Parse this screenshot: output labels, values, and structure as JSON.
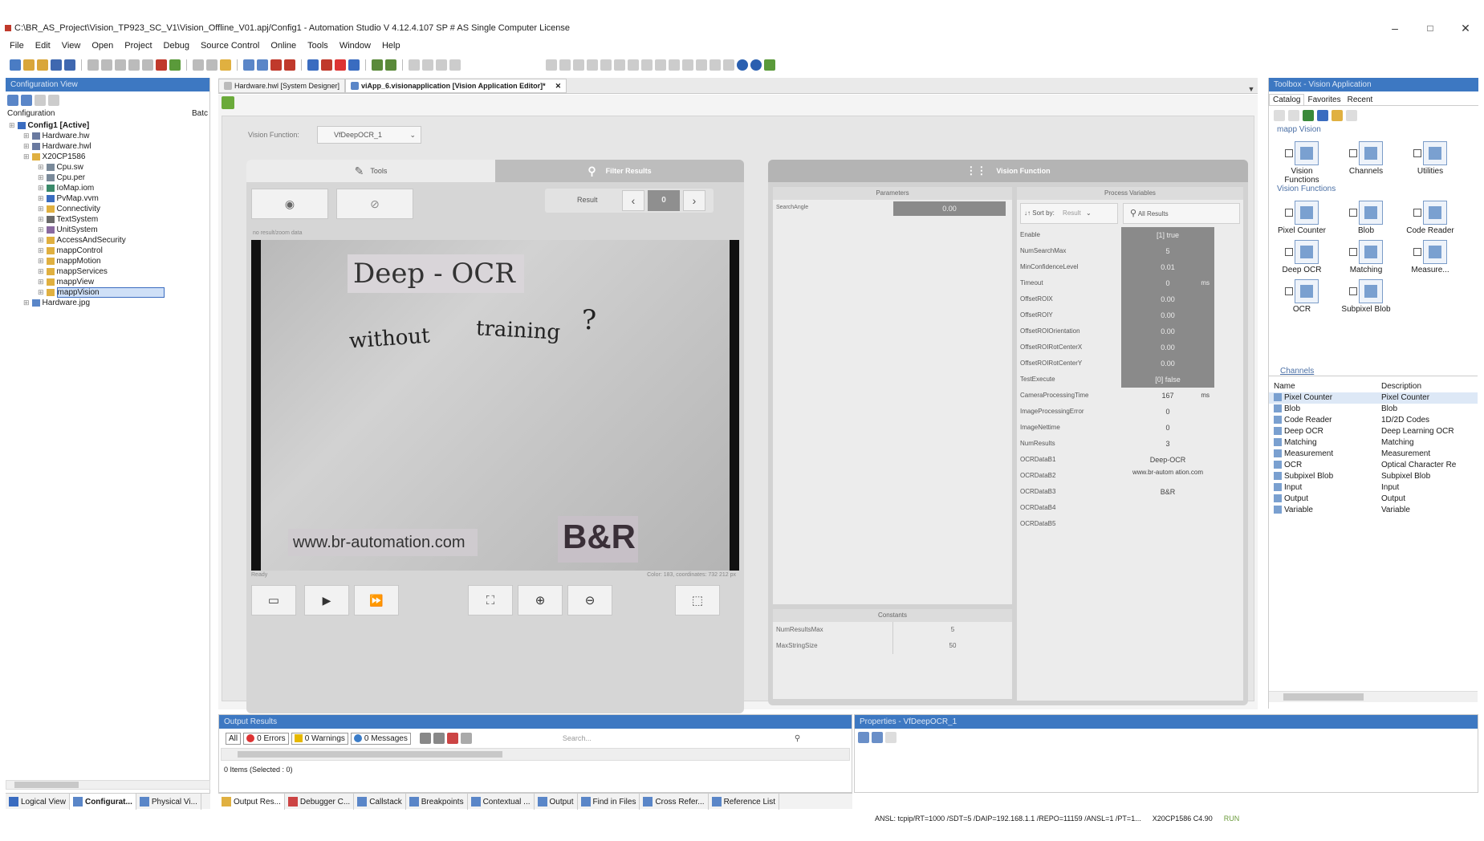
{
  "window": {
    "title": "C:\\BR_AS_Project\\Vision_TP923_SC_V1\\Vision_Offline_V01.apj/Config1 - Automation Studio V 4.12.4.107 SP # AS Single Computer License",
    "minimize": "–",
    "restore": "□",
    "close": "✕"
  },
  "menu": [
    "File",
    "Edit",
    "View",
    "Open",
    "Project",
    "Debug",
    "Source Control",
    "Online",
    "Tools",
    "Window",
    "Help"
  ],
  "config_view": {
    "header": "Configuration View",
    "col_config": "Configuration",
    "col_bat": "Batc",
    "tree": [
      {
        "label": "Config1 [Active]",
        "level": 0,
        "icon": "config-icon",
        "bold": true
      },
      {
        "label": "Hardware.hw",
        "level": 1,
        "icon": "hardware-icon"
      },
      {
        "label": "Hardware.hwl",
        "level": 1,
        "icon": "hardware-icon"
      },
      {
        "label": "X20CP1586",
        "level": 1,
        "icon": "folder-icon"
      },
      {
        "label": "Cpu.sw",
        "level": 2,
        "icon": "cpu-icon"
      },
      {
        "label": "Cpu.per",
        "level": 2,
        "icon": "cpu-icon"
      },
      {
        "label": "IoMap.iom",
        "level": 2,
        "icon": "iomap-icon"
      },
      {
        "label": "PvMap.vvm",
        "level": 2,
        "icon": "pvmap-icon"
      },
      {
        "label": "Connectivity",
        "level": 2,
        "icon": "folder-icon"
      },
      {
        "label": "TextSystem",
        "level": 2,
        "icon": "text-icon"
      },
      {
        "label": "UnitSystem",
        "level": 2,
        "icon": "unit-icon"
      },
      {
        "label": "AccessAndSecurity",
        "level": 2,
        "icon": "folder-icon"
      },
      {
        "label": "mappControl",
        "level": 2,
        "icon": "folder-icon"
      },
      {
        "label": "mappMotion",
        "level": 2,
        "icon": "folder-icon"
      },
      {
        "label": "mappServices",
        "level": 2,
        "icon": "folder-icon"
      },
      {
        "label": "mappView",
        "level": 2,
        "icon": "folder-icon"
      },
      {
        "label": "mappVision",
        "level": 2,
        "icon": "folder-icon",
        "selected": true
      },
      {
        "label": "Hardware.jpg",
        "level": 1,
        "icon": "image-icon"
      }
    ]
  },
  "doc_tabs": [
    {
      "label": "Hardware.hwl [System Designer]",
      "active": false
    },
    {
      "label": "viApp_6.visionapplication [Vision Application Editor]*",
      "active": true
    }
  ],
  "editor": {
    "vision_function_label": "Vision Function:",
    "vision_function_value": "VfDeepOCR_1",
    "tab_tools": "Tools",
    "tab_filter": "Filter Results",
    "result_label": "Result",
    "result_index": "0",
    "no_result_hint": "no result/zoom data",
    "image_text_line1": "Deep - OCR",
    "image_text_line2a": "without",
    "image_text_line2b": "training",
    "image_text_qmark": "?",
    "image_url": "www.br-automation.com",
    "image_logo": "B&R",
    "status_left": "Ready",
    "status_right": "Color: 183, coordinates: 732   212 px"
  },
  "vision_function_panel": {
    "header": "Vision Function",
    "parameters_header": "Parameters",
    "parameters": [
      {
        "name": "SearchAngle",
        "value": "0.00"
      }
    ],
    "process_header": "Process Variables",
    "sort_label": "Sort by:",
    "sort_value": "Result",
    "all_results": "All Results",
    "process_vars": [
      {
        "name": "Enable",
        "value": "[1] true",
        "dark": true
      },
      {
        "name": "NumSearchMax",
        "value": "5",
        "dark": true
      },
      {
        "name": "MinConfidenceLevel",
        "value": "0.01",
        "dark": true
      },
      {
        "name": "Timeout",
        "value": "0",
        "unit": "ms",
        "dark": true
      },
      {
        "name": "OffsetROIX",
        "value": "0.00",
        "dark": true
      },
      {
        "name": "OffsetROIY",
        "value": "0.00",
        "dark": true
      },
      {
        "name": "OffsetROIOrientation",
        "value": "0.00",
        "dark": true
      },
      {
        "name": "OffsetROIRotCenterX",
        "value": "0.00",
        "dark": true
      },
      {
        "name": "OffsetROIRotCenterY",
        "value": "0.00",
        "dark": true
      },
      {
        "name": "TestExecute",
        "value": "[0] false",
        "dark": true
      },
      {
        "name": "CameraProcessingTime",
        "value": "167",
        "unit": "ms",
        "dark": false
      },
      {
        "name": "ImageProcessingError",
        "value": "0",
        "dark": false
      },
      {
        "name": "ImageNettime",
        "value": "0",
        "dark": false
      },
      {
        "name": "NumResults",
        "value": "3",
        "dark": false
      },
      {
        "name": "OCRDataB1",
        "value": "Deep-OCR",
        "dark": false
      },
      {
        "name": "OCRDataB2",
        "value": "www.br-autom ation.com",
        "dark": false
      },
      {
        "name": "OCRDataB3",
        "value": "B&R",
        "dark": false
      },
      {
        "name": "OCRDataB4",
        "value": "",
        "dark": false
      },
      {
        "name": "OCRDataB5",
        "value": "",
        "dark": false
      }
    ],
    "constants_header": "Constants",
    "constants": [
      {
        "name": "NumResultsMax",
        "value": "5"
      },
      {
        "name": "MaxStringSize",
        "value": "50"
      }
    ]
  },
  "toolbox": {
    "header": "Toolbox - Vision Application",
    "tabs": [
      "Catalog",
      "Favorites",
      "Recent"
    ],
    "group_mapp": "mapp Vision",
    "items_row1": [
      {
        "label": "Vision Functions",
        "icon": "vision-functions-icon"
      },
      {
        "label": "Channels",
        "icon": "channels-icon"
      },
      {
        "label": "Utilities",
        "icon": "utilities-icon"
      }
    ],
    "group_vf": "Vision Functions",
    "items_vf": [
      {
        "label": "Pixel Counter",
        "icon": "pixel-counter-icon"
      },
      {
        "label": "Blob",
        "icon": "blob-icon"
      },
      {
        "label": "Code Reader",
        "icon": "code-reader-icon"
      },
      {
        "label": "Deep OCR",
        "icon": "deep-ocr-icon"
      },
      {
        "label": "Matching",
        "icon": "matching-icon"
      },
      {
        "label": "Measure...",
        "icon": "measurement-icon"
      },
      {
        "label": "OCR",
        "icon": "ocr-icon"
      },
      {
        "label": "Subpixel Blob",
        "icon": "subpixel-blob-icon"
      }
    ],
    "channels_link": "Channels",
    "col_name": "Name",
    "col_desc": "Description",
    "list": [
      {
        "name": "Pixel Counter",
        "desc": "Pixel Counter"
      },
      {
        "name": "Blob",
        "desc": "Blob"
      },
      {
        "name": "Code Reader",
        "desc": "1D/2D Codes"
      },
      {
        "name": "Deep OCR",
        "desc": "Deep Learning OCR"
      },
      {
        "name": "Matching",
        "desc": "Matching"
      },
      {
        "name": "Measurement",
        "desc": "Measurement"
      },
      {
        "name": "OCR",
        "desc": "Optical Character Re"
      },
      {
        "name": "Subpixel Blob",
        "desc": "Subpixel Blob"
      },
      {
        "name": "Input",
        "desc": "Input"
      },
      {
        "name": "Output",
        "desc": "Output"
      },
      {
        "name": "Variable",
        "desc": "Variable"
      }
    ]
  },
  "output": {
    "header": "Output Results",
    "all": "All",
    "errors": "0 Errors",
    "warnings": "0 Warnings",
    "messages": "0 Messages",
    "search_placeholder": "Search...",
    "items": "0 Items (Selected : 0)"
  },
  "properties": {
    "header": "Properties - VfDeepOCR_1"
  },
  "left_bottom_tabs": [
    "Logical View",
    "Configurat...",
    "Physical Vi..."
  ],
  "bottom_tabs": [
    "Output Res...",
    "Debugger C...",
    "Callstack",
    "Breakpoints",
    "Contextual ...",
    "Output",
    "Find in Files",
    "Cross Refer...",
    "Reference List"
  ],
  "statusbar": {
    "text": "ANSL: tcpip/RT=1000 /SDT=5 /DAIP=192.168.1.1 /REPO=11159 /ANSL=1 /PT=1...",
    "cpu": "X20CP1586  C4.90",
    "mode": "RUN"
  },
  "colors": {
    "panel_header": "#3d78c2",
    "dark_value": "#8a8a8a",
    "panel_bg": "#e2e2e2"
  }
}
